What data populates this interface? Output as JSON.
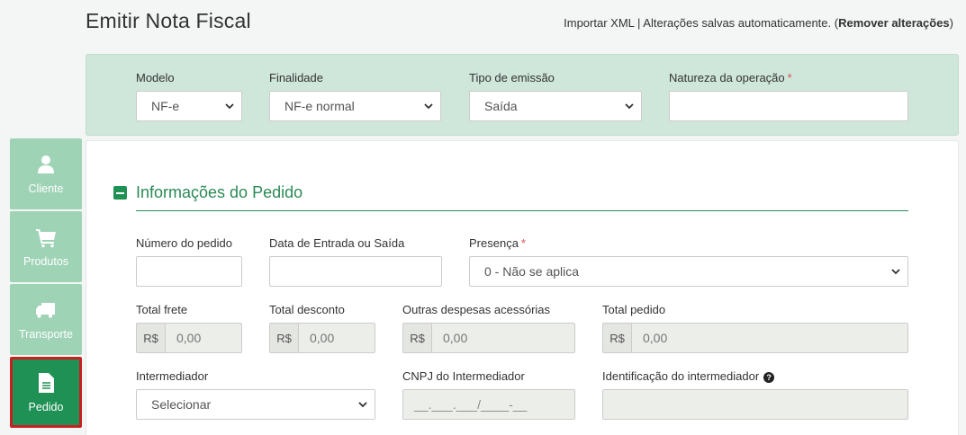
{
  "page": {
    "title": "Emitir Nota Fiscal",
    "import_link": "Importar XML",
    "separator": " | ",
    "autosave_text": "Alterações salvas automaticamente. (",
    "remove_link": "Remover alterações",
    "close_paren": ")"
  },
  "header": {
    "modelo": {
      "label": "Modelo",
      "value": "NF-e"
    },
    "finalidade": {
      "label": "Finalidade",
      "value": "NF-e normal"
    },
    "tipo_emissao": {
      "label": "Tipo de emissão",
      "value": "Saída"
    },
    "natureza": {
      "label": "Natureza da operação",
      "required": "*",
      "value": ""
    }
  },
  "sidebar": {
    "items": [
      {
        "label": "Cliente",
        "icon": "user-icon"
      },
      {
        "label": "Produtos",
        "icon": "cart-icon"
      },
      {
        "label": "Transporte",
        "icon": "truck-icon"
      },
      {
        "label": "Pedido",
        "icon": "document-icon"
      }
    ]
  },
  "section": {
    "title": "Informações do Pedido",
    "numero_pedido": {
      "label": "Número do pedido",
      "value": ""
    },
    "data_entrada": {
      "label": "Data de Entrada ou Saída",
      "value": ""
    },
    "presenca": {
      "label": "Presença",
      "required": "*",
      "value": "0 - Não se aplica"
    },
    "total_frete": {
      "label": "Total frete",
      "currency": "R$",
      "value": "0,00"
    },
    "total_desconto": {
      "label": "Total desconto",
      "currency": "R$",
      "value": "0,00"
    },
    "outras_despesas": {
      "label": "Outras despesas acessórias",
      "currency": "R$",
      "value": "0,00"
    },
    "total_pedido": {
      "label": "Total pedido",
      "currency": "R$",
      "value": "0,00"
    },
    "intermediador": {
      "label": "Intermediador",
      "value": "Selecionar"
    },
    "cnpj_intermediador": {
      "label": "CNPJ do Intermediador",
      "value": "__.___.___/____-__"
    },
    "identificacao_intermediador": {
      "label": "Identificação do intermediador",
      "help": "?",
      "value": ""
    }
  },
  "colors": {
    "accent": "#1f9155",
    "header_band": "#cfe6da",
    "sidebar_inactive": "#9fd3b6",
    "active_border": "#c8201f",
    "required": "#d9534f"
  }
}
